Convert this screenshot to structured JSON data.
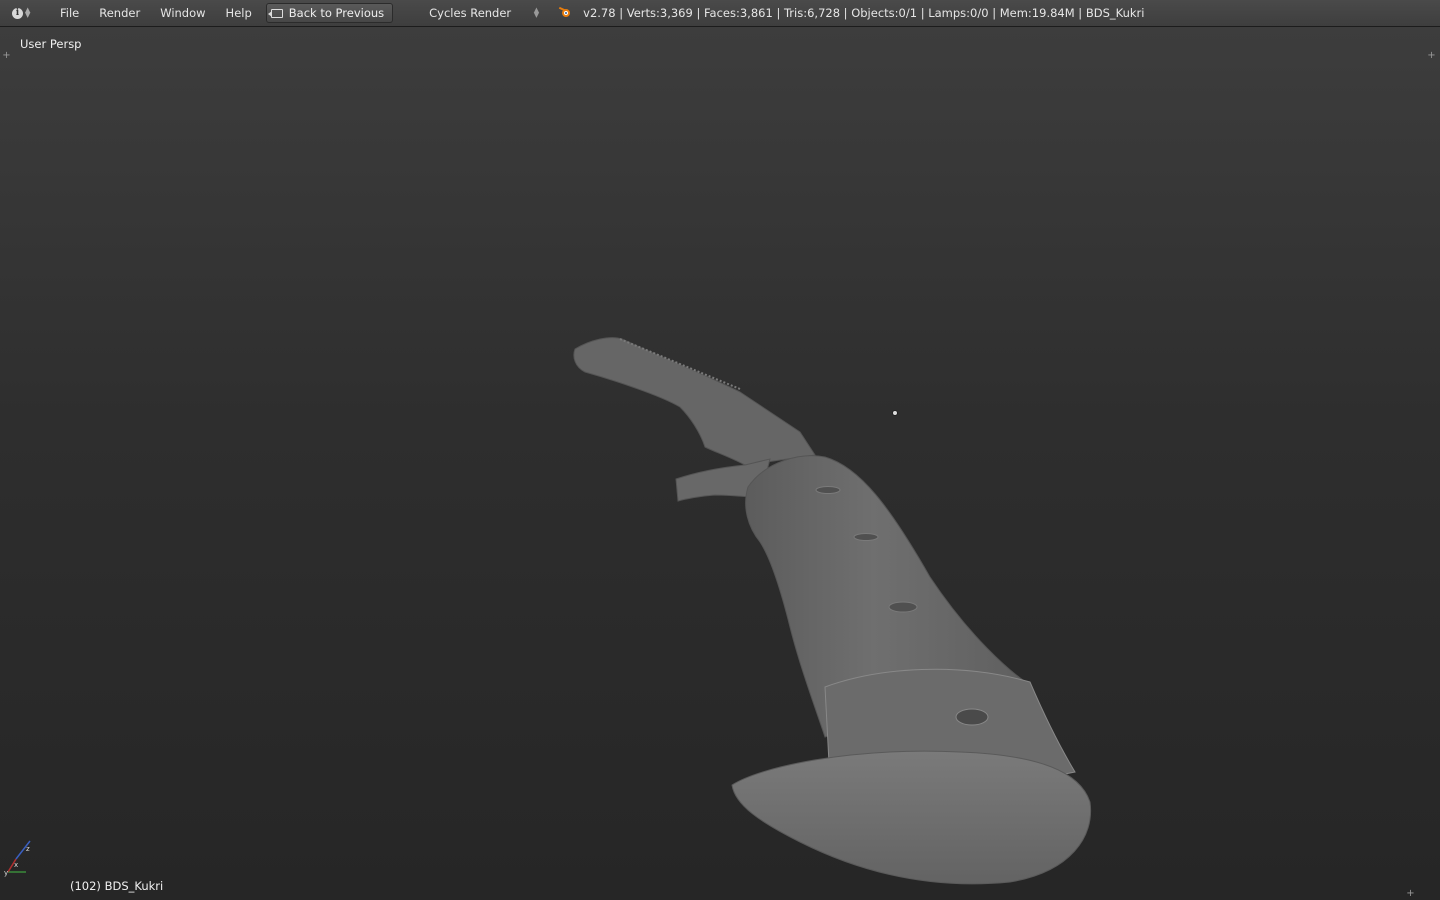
{
  "header": {
    "editor_type_icon": "info-icon",
    "menu": [
      "File",
      "Render",
      "Window",
      "Help"
    ],
    "back_button": "Back to Previous",
    "render_engine": "Cycles Render",
    "logo_icon": "blender-logo-icon",
    "stats": "v2.78 | Verts:3,369 | Faces:3,861 | Tris:6,728 | Objects:0/1 | Lamps:0/0 | Mem:19.84M | BDS_Kukri"
  },
  "viewport": {
    "view_label": "User Persp",
    "object_label": "(102) BDS_Kukri",
    "gizmo_axes": {
      "x": "x",
      "y": "y",
      "z": "z"
    }
  },
  "colors": {
    "header_bg": "#444444",
    "viewport_top": "#3d3d3d",
    "viewport_bottom": "#262626",
    "model_gray": "#6e6e6e",
    "accent_orange": "#e87d0d"
  }
}
